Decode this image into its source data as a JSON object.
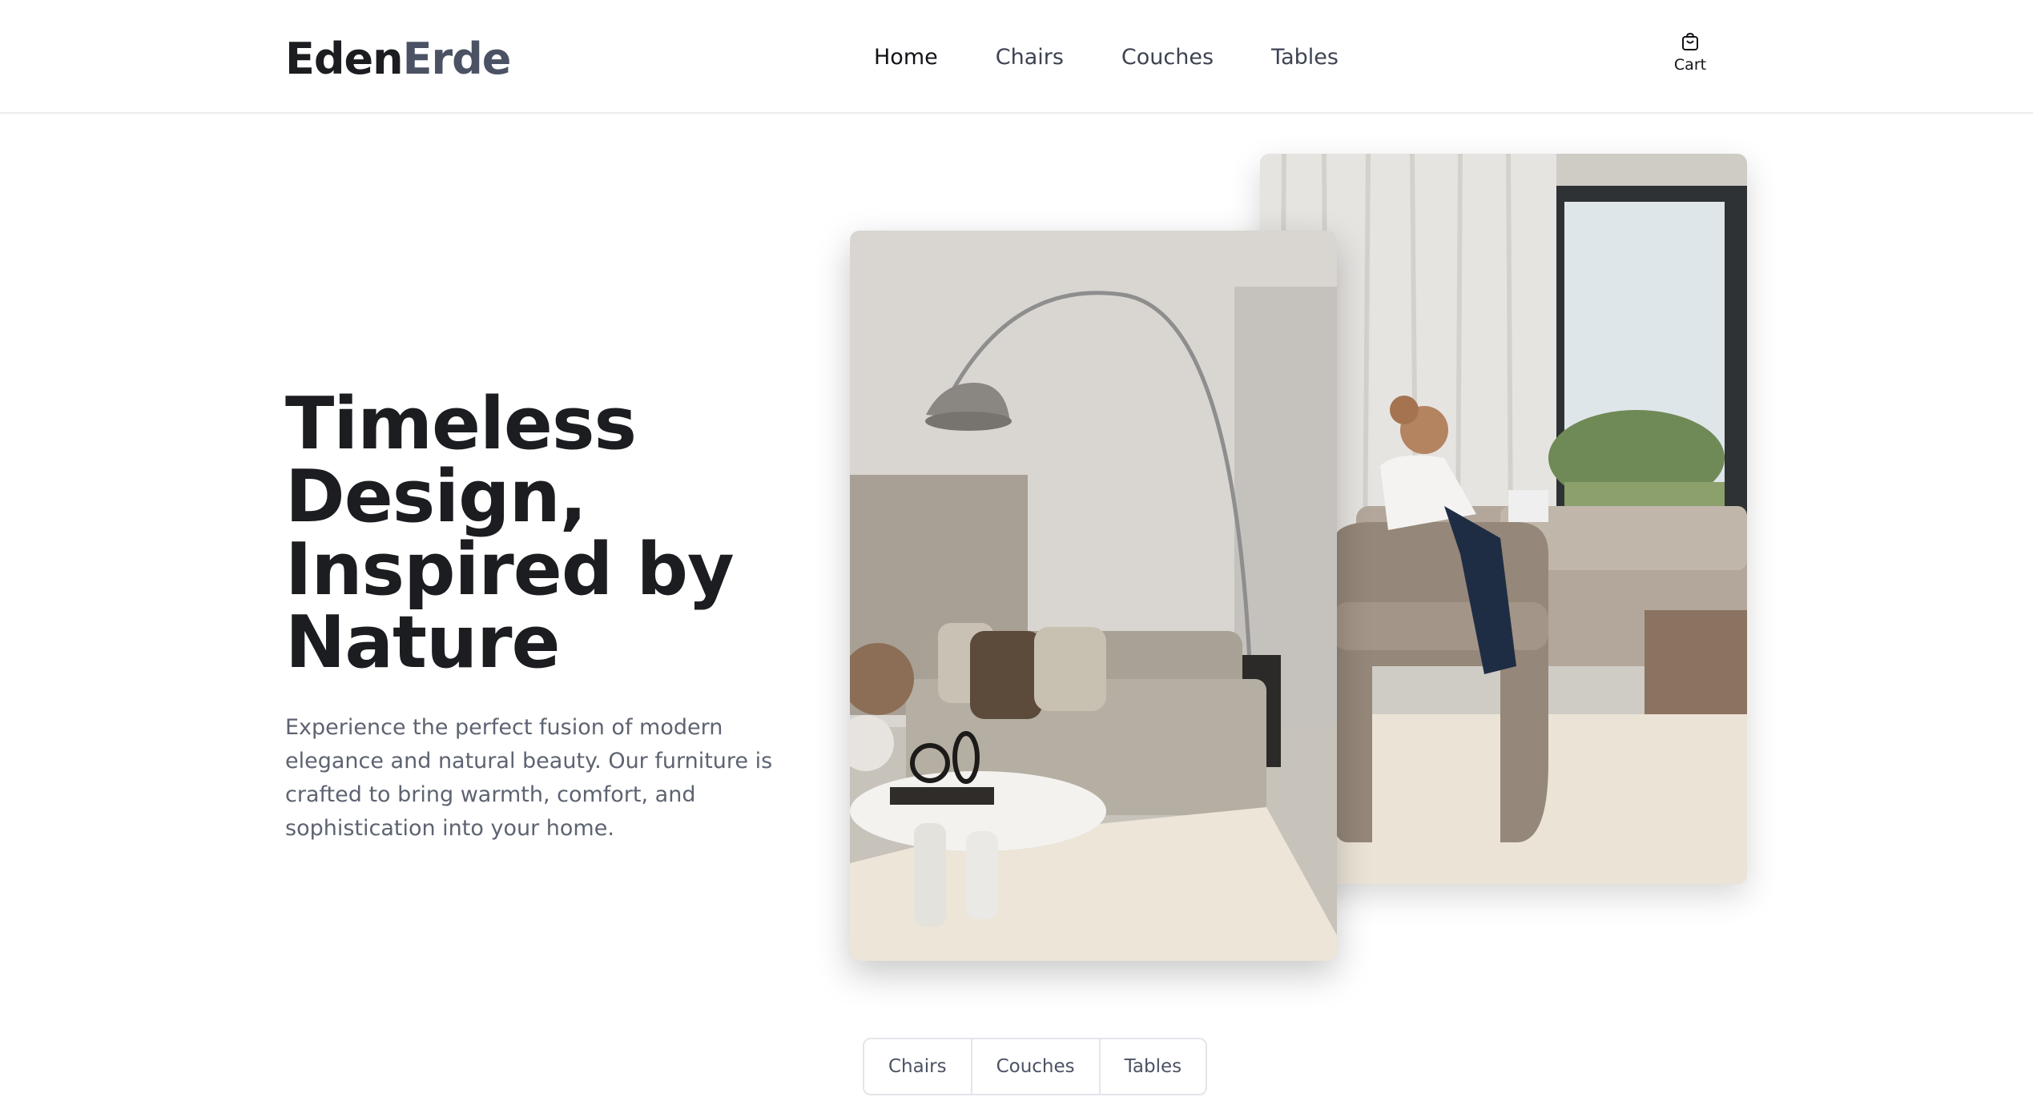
{
  "brand": {
    "part1": "Eden",
    "part2": "Erde"
  },
  "nav": {
    "items": [
      {
        "label": "Home",
        "active": true
      },
      {
        "label": "Chairs",
        "active": false
      },
      {
        "label": "Couches",
        "active": false
      },
      {
        "label": "Tables",
        "active": false
      }
    ]
  },
  "cart": {
    "label": "Cart",
    "icon": "shopping-bag-icon"
  },
  "hero": {
    "title_lines": [
      "Timeless",
      "Design,",
      "Inspired by",
      "Nature"
    ],
    "description": "Experience the perfect fusion of modern elegance and natural beauty. Our furniture is crafted to bring warmth, comfort, and sophistication into your home."
  },
  "images": {
    "front": "living-room-with-arc-lamp-photo",
    "back": "woman-reading-in-armchair-photo"
  },
  "category_tabs": [
    "Chairs",
    "Couches",
    "Tables"
  ],
  "colors": {
    "text_dark": "#1c1d21",
    "brand_accent": "#4b5263",
    "muted": "#5d6371"
  }
}
